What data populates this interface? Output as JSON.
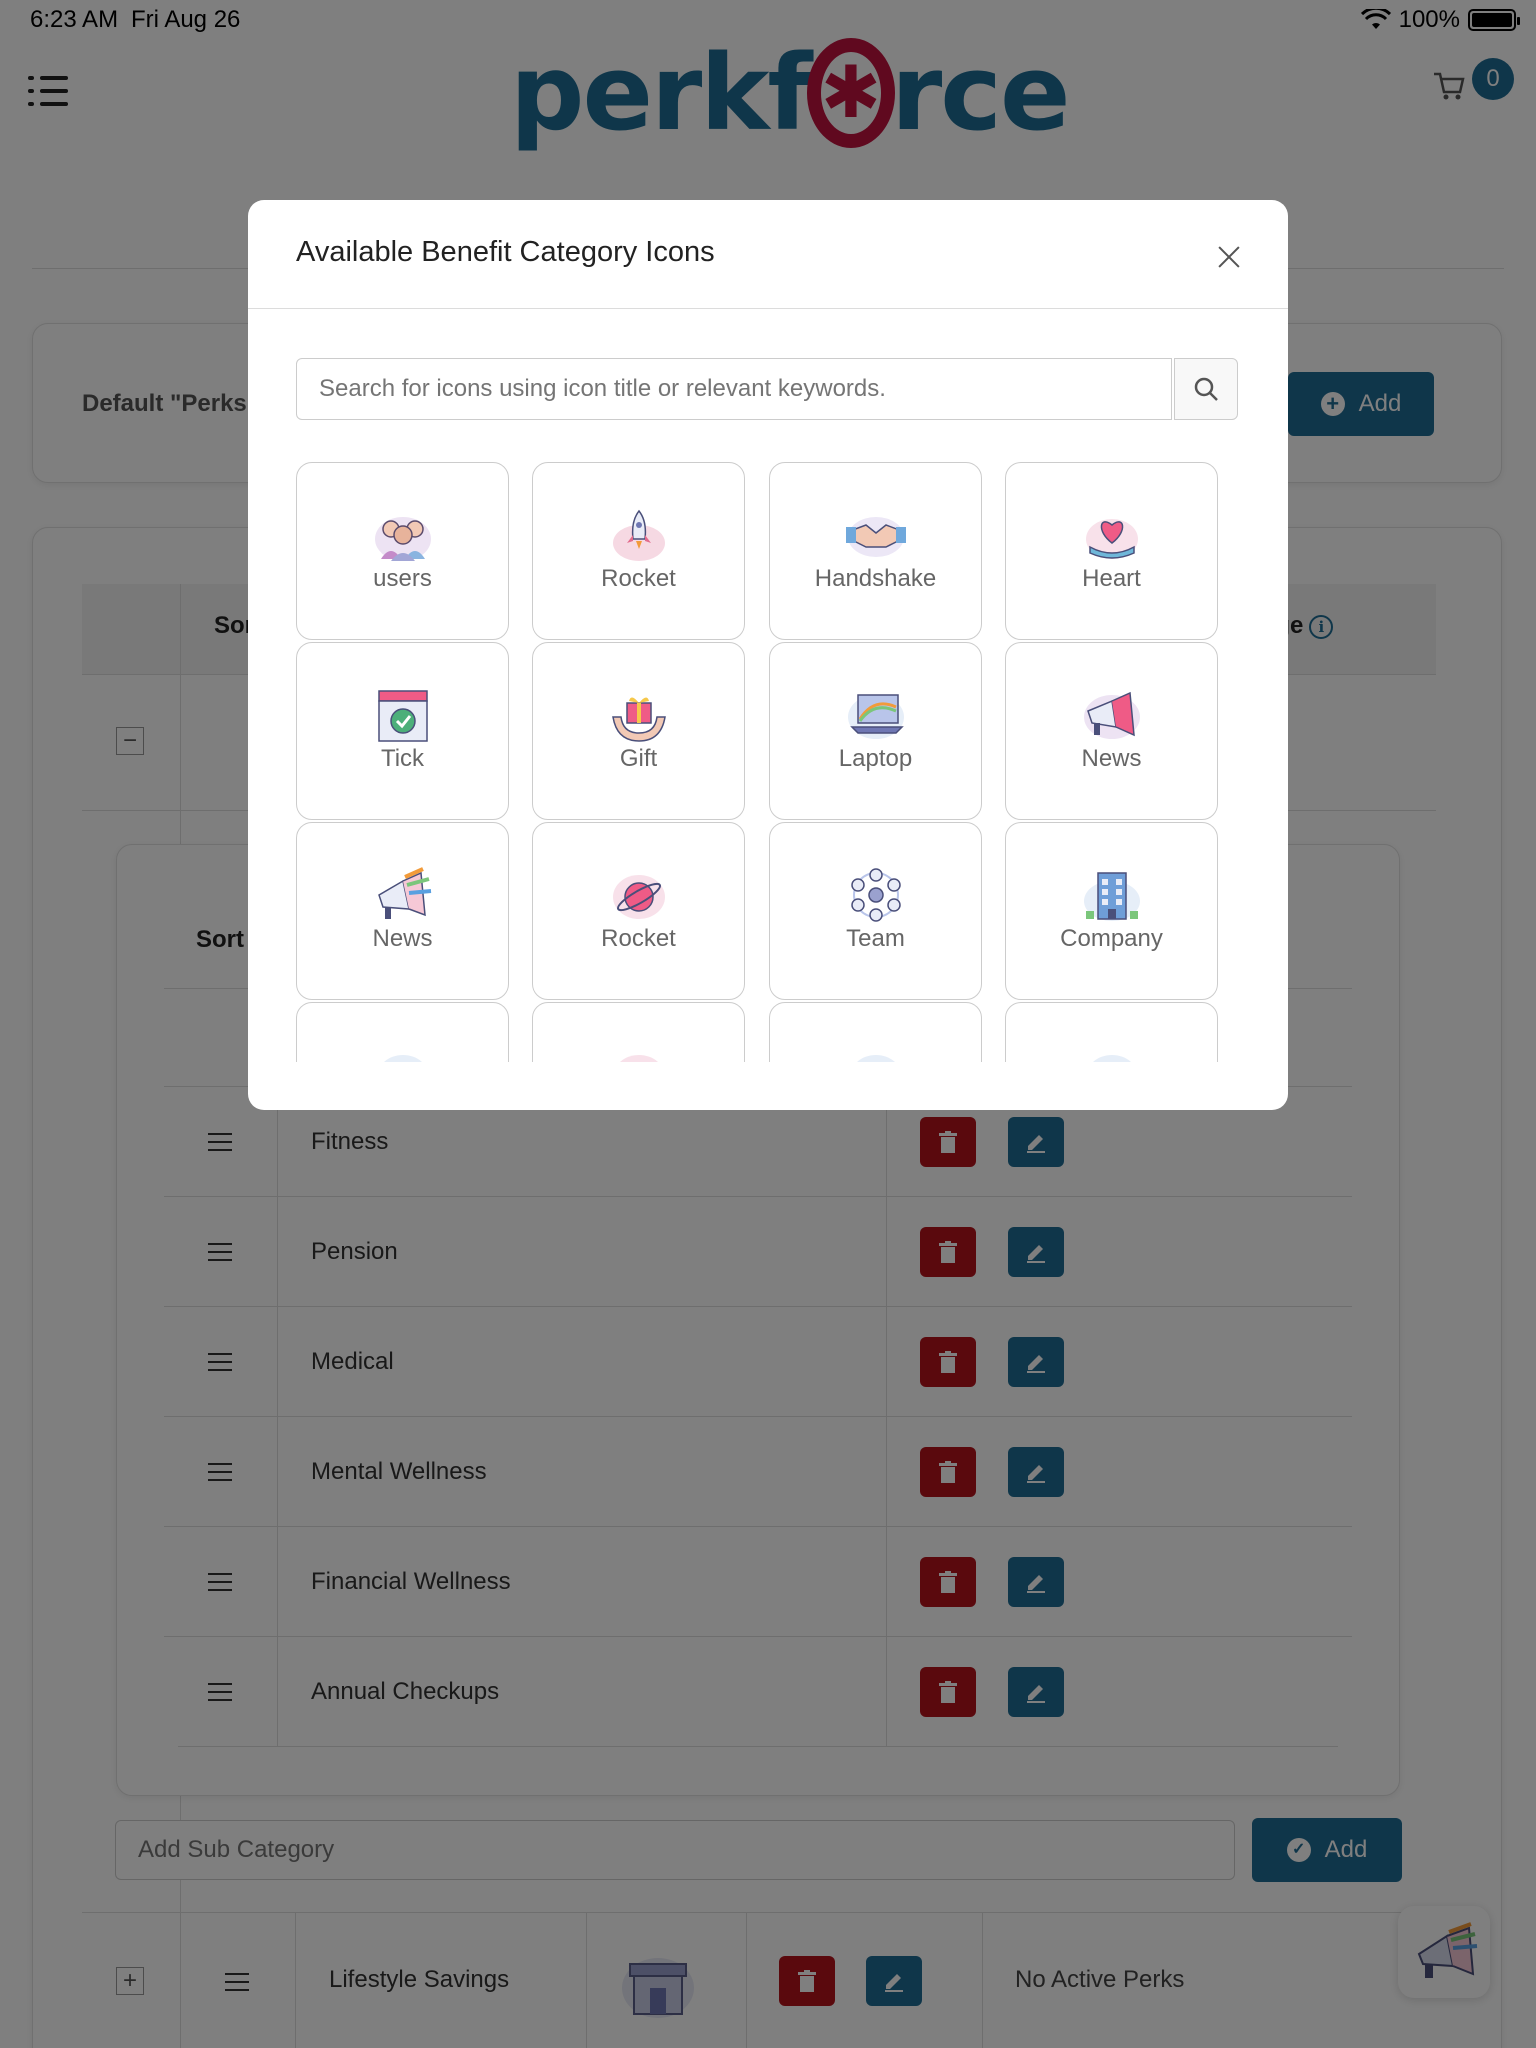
{
  "status_bar": {
    "time": "6:23 AM",
    "date": "Fri Aug 26",
    "battery": "100%"
  },
  "header": {
    "logo_text_left": "perkf",
    "logo_text_right": "rce",
    "cart_count": "0"
  },
  "default_section": {
    "label": "Default \"Perks",
    "add_label": "Add"
  },
  "main_table": {
    "header_sort": "Sor",
    "header_image": "age",
    "sub_table": {
      "header_sort": "Sort",
      "rows": [
        {
          "label": "Fitness"
        },
        {
          "label": "Pension"
        },
        {
          "label": "Medical"
        },
        {
          "label": "Mental Wellness"
        },
        {
          "label": "Financial Wellness"
        },
        {
          "label": "Annual Checkups"
        }
      ]
    },
    "add_sub_placeholder": "Add Sub Category",
    "add_sub_label": "Add",
    "lifestyle_row": {
      "label": "Lifestyle Savings",
      "status": "No Active Perks"
    }
  },
  "modal": {
    "title": "Available Benefit Category Icons",
    "search_placeholder": "Search for icons using icon title or relevant keywords.",
    "icons": [
      {
        "label": "users",
        "icon": "users-icon"
      },
      {
        "label": "Rocket",
        "icon": "rocket-icon"
      },
      {
        "label": "Handshake",
        "icon": "handshake-icon"
      },
      {
        "label": "Heart",
        "icon": "heart-icon"
      },
      {
        "label": "Tick",
        "icon": "tick-icon"
      },
      {
        "label": "Gift",
        "icon": "gift-icon"
      },
      {
        "label": "Laptop",
        "icon": "laptop-icon"
      },
      {
        "label": "News",
        "icon": "megaphone-icon"
      },
      {
        "label": "News",
        "icon": "megaphone-icon"
      },
      {
        "label": "Rocket",
        "icon": "planet-icon"
      },
      {
        "label": "Team",
        "icon": "team-icon"
      },
      {
        "label": "Company",
        "icon": "building-icon"
      }
    ]
  },
  "colors": {
    "brand_blue": "#1f6d94",
    "brand_red": "#c0123f",
    "delete_red": "#b5121b"
  }
}
